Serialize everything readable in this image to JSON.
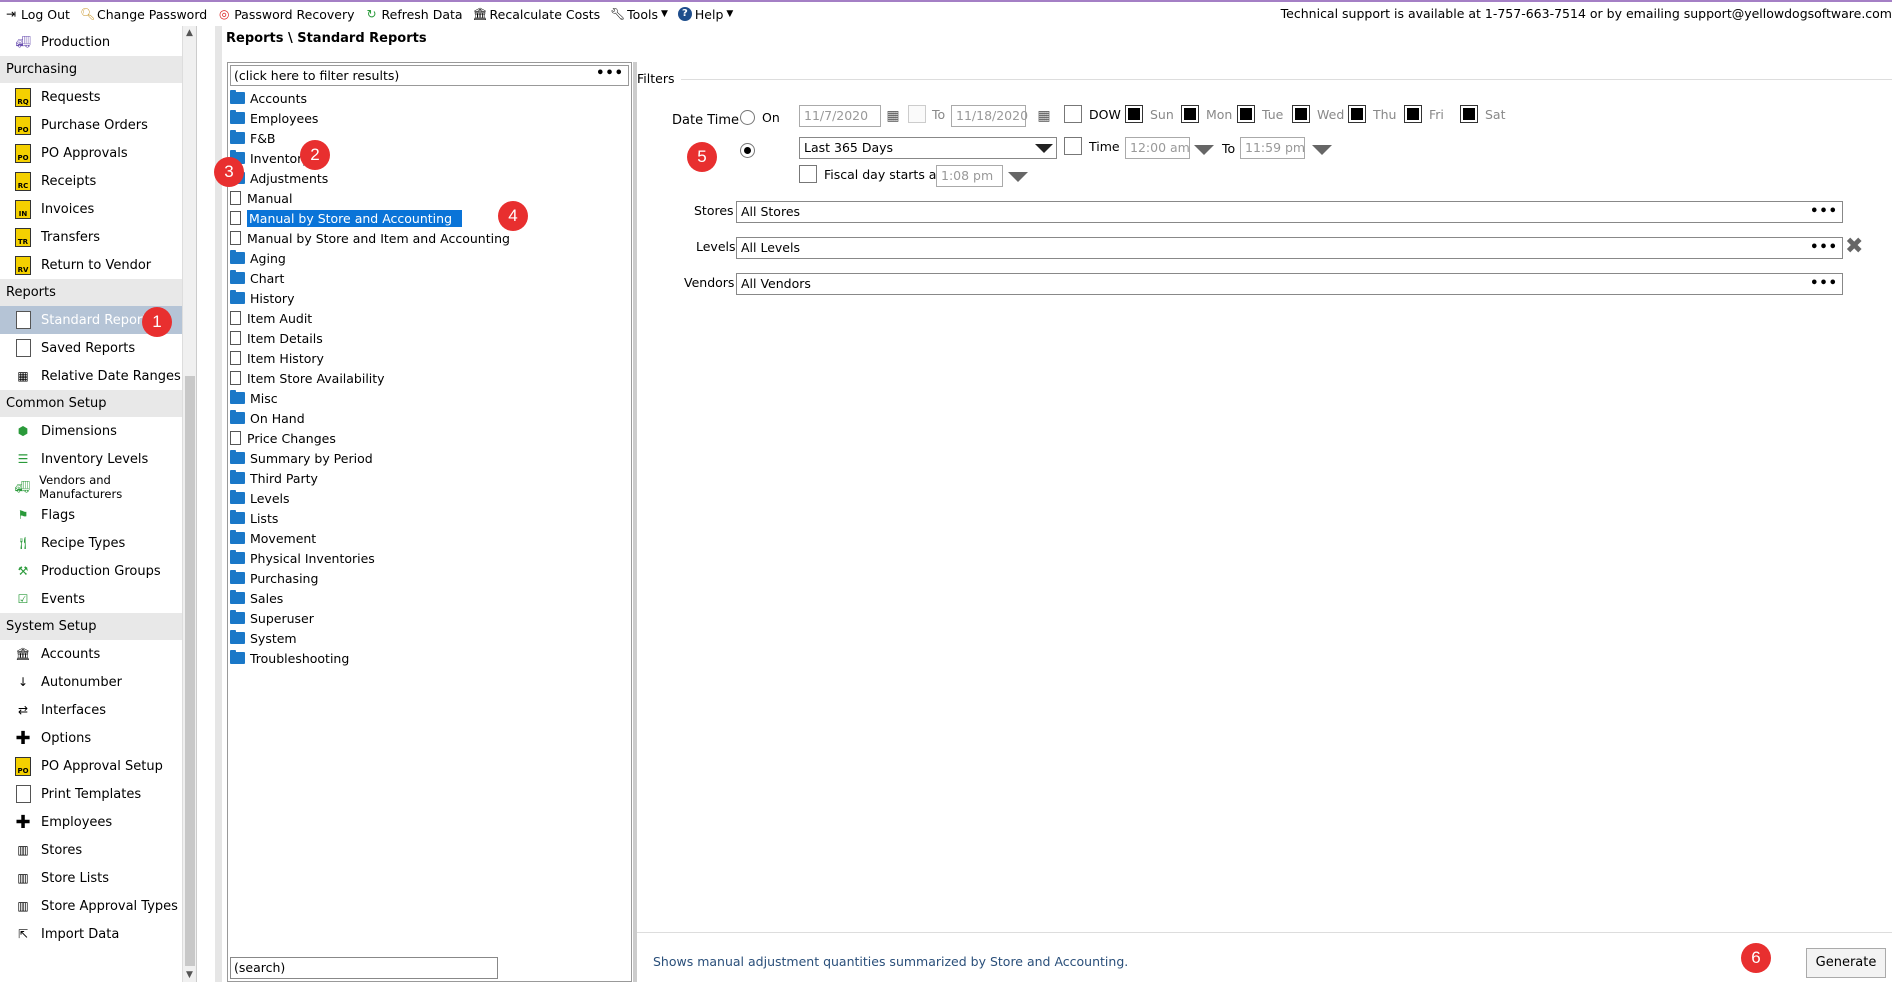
{
  "toolbar": {
    "items": [
      {
        "label": "Log Out",
        "icon": "logout-icon"
      },
      {
        "label": "Change Password",
        "icon": "key-icon"
      },
      {
        "label": "Password Recovery",
        "icon": "lifebuoy-icon"
      },
      {
        "label": "Refresh Data",
        "icon": "refresh-icon"
      },
      {
        "label": "Recalculate Costs",
        "icon": "bank-icon"
      },
      {
        "label": "Tools",
        "icon": "wrench-icon"
      },
      {
        "label": "Help",
        "icon": "help-icon"
      }
    ],
    "support_text": "Technical support is available at 1-757-663-7514 or by emailing support@yellowdogsoftware.com"
  },
  "sidebar": {
    "top_item": "Production",
    "purchasing": {
      "title": "Purchasing",
      "items": [
        "Requests",
        "Purchase Orders",
        "PO Approvals",
        "Receipts",
        "Invoices",
        "Transfers",
        "Return to Vendor"
      ],
      "icon_codes": [
        "RQ",
        "PO",
        "PO",
        "RC",
        "IN",
        "TR",
        "RV"
      ]
    },
    "reports": {
      "title": "Reports",
      "items": [
        "Standard Reports",
        "Saved Reports",
        "Relative Date Ranges"
      ]
    },
    "common_setup": {
      "title": "Common Setup",
      "items": [
        "Dimensions",
        "Inventory Levels",
        "Vendors and Manufacturers",
        "Flags",
        "Recipe Types",
        "Production Groups",
        "Events"
      ]
    },
    "system_setup": {
      "title": "System Setup",
      "items": [
        "Accounts",
        "Autonumber",
        "Interfaces",
        "Options",
        "PO Approval Setup",
        "Print Templates",
        "Employees",
        "Stores",
        "Store Lists",
        "Store Approval Types",
        "Import Data"
      ]
    }
  },
  "breadcrumb": "Reports \\ Standard Reports",
  "tree": {
    "filter_placeholder": "(click here to filter results)",
    "search_placeholder": "(search)",
    "rows": [
      {
        "label": "Accounts",
        "type": "folder",
        "indent": 0
      },
      {
        "label": "Employees",
        "type": "folder",
        "indent": 0
      },
      {
        "label": "F&B",
        "type": "folder",
        "indent": 0
      },
      {
        "label": "Inventory",
        "type": "folder-open",
        "indent": 0
      },
      {
        "label": "Adjustments",
        "type": "folder-open",
        "indent": 1
      },
      {
        "label": "Manual",
        "type": "report",
        "indent": 2
      },
      {
        "label": "Manual by Store and Accounting",
        "type": "report",
        "indent": 2,
        "selected": true
      },
      {
        "label": "Manual by Store and Item and Accounting",
        "type": "report",
        "indent": 2
      },
      {
        "label": "Aging",
        "type": "folder",
        "indent": 1
      },
      {
        "label": "Chart",
        "type": "folder",
        "indent": 1
      },
      {
        "label": "History",
        "type": "folder",
        "indent": 1
      },
      {
        "label": "Item Audit",
        "type": "report",
        "indent": 1
      },
      {
        "label": "Item Details",
        "type": "report",
        "indent": 1
      },
      {
        "label": "Item History",
        "type": "report",
        "indent": 1
      },
      {
        "label": "Item Store Availability",
        "type": "report",
        "indent": 1
      },
      {
        "label": "Misc",
        "type": "folder",
        "indent": 1
      },
      {
        "label": "On Hand",
        "type": "folder",
        "indent": 1
      },
      {
        "label": "Price Changes",
        "type": "report",
        "indent": 1
      },
      {
        "label": "Summary by Period",
        "type": "folder",
        "indent": 1
      },
      {
        "label": "Third Party",
        "type": "folder",
        "indent": 1
      },
      {
        "label": "Levels",
        "type": "folder",
        "indent": 0
      },
      {
        "label": "Lists",
        "type": "folder",
        "indent": 0
      },
      {
        "label": "Movement",
        "type": "folder",
        "indent": 0
      },
      {
        "label": "Physical Inventories",
        "type": "folder",
        "indent": 0
      },
      {
        "label": "Purchasing",
        "type": "folder",
        "indent": 0
      },
      {
        "label": "Sales",
        "type": "folder",
        "indent": 0
      },
      {
        "label": "Superuser",
        "type": "folder",
        "indent": 0
      },
      {
        "label": "System",
        "type": "folder",
        "indent": 0
      },
      {
        "label": "Troubleshooting",
        "type": "folder",
        "indent": 0
      }
    ]
  },
  "filters": {
    "title": "Filters",
    "date_time_label": "Date Time",
    "on_label": "On",
    "date_from": "11/7/2020",
    "to_label": "To",
    "date_to": "11/18/2020",
    "dow_label": "DOW",
    "days": [
      "Sun",
      "Mon",
      "Tue",
      "Wed",
      "Thu",
      "Fri",
      "Sat"
    ],
    "range_value": "Last 365 Days",
    "time_label": "Time",
    "time_from": "12:00 am",
    "time_to_label": "To",
    "time_to": "11:59 pm",
    "fiscal_label": "Fiscal day starts at",
    "fiscal_time": "1:08 pm",
    "stores_label": "Stores",
    "stores_value": "All Stores",
    "levels_label": "Levels",
    "levels_value": "All Levels",
    "vendors_label": "Vendors",
    "vendors_value": "All Vendors"
  },
  "footer": {
    "description": "Shows manual adjustment quantities summarized by Store and Accounting.",
    "generate_label": "Generate"
  },
  "badges": [
    "1",
    "2",
    "3",
    "4",
    "5",
    "6"
  ]
}
